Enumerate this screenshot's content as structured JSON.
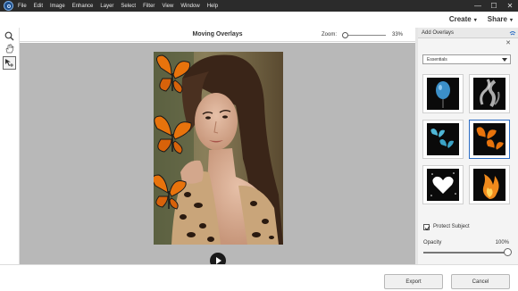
{
  "menu": {
    "items": [
      "File",
      "Edit",
      "Image",
      "Enhance",
      "Layer",
      "Select",
      "Filter",
      "View",
      "Window",
      "Help"
    ]
  },
  "window_controls": {
    "minimize": "—",
    "maximize": "☐",
    "close": "✕"
  },
  "header": {
    "create_label": "Create",
    "share_label": "Share"
  },
  "canvas": {
    "title": "Moving Overlays",
    "zoom_label": "Zoom:",
    "zoom_value": "33%",
    "zoom_fraction": 0.05
  },
  "panel": {
    "tab_label": "Add Overlays",
    "dropdown_value": "Essentials",
    "thumbnails": [
      "balloon",
      "smoke",
      "butterflies-blue",
      "butterflies-orange",
      "heart",
      "fire"
    ],
    "selected_thumbnail": "butterflies-orange",
    "protect_subject_label": "Protect Subject",
    "protect_subject_checked": true,
    "opacity_label": "Opacity",
    "opacity_value": "100%",
    "opacity_fraction": 1.0
  },
  "footer": {
    "export_label": "Export",
    "cancel_label": "Cancel"
  },
  "colors": {
    "accent": "#2b6cc4",
    "menubar": "#2b2b2b",
    "canvas_bg": "#b8b8b8",
    "butterfly": "#e8730c"
  }
}
